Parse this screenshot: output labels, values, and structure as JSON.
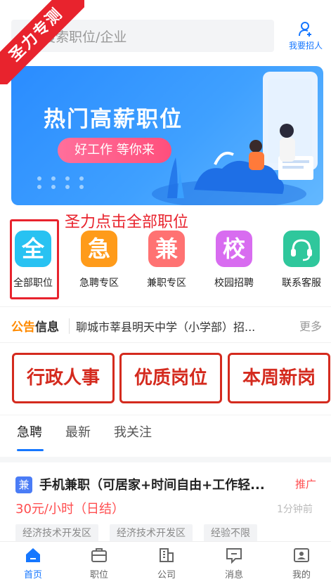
{
  "watermark": "圣力专测",
  "search": {
    "placeholder": "搜索职位/企业"
  },
  "header": {
    "recruit_label": "我要招人"
  },
  "banner": {
    "title": "热门高薪职位",
    "button_label": "好工作 等你来"
  },
  "annotation": "圣力点击全部职位",
  "categories": [
    {
      "icon_char": "全",
      "label": "全部职位",
      "color": "#28c2f2"
    },
    {
      "icon_char": "急",
      "label": "急聘专区",
      "color": "#ff9b1a"
    },
    {
      "icon_char": "兼",
      "label": "兼职专区",
      "color": "#ff7272"
    },
    {
      "icon_char": "校",
      "label": "校园招聘",
      "color": "#d86cf0"
    },
    {
      "icon_char": "",
      "label": "联系客服",
      "color": "#2fc79c"
    }
  ],
  "notice": {
    "logo_a": "公告",
    "logo_b": "信息",
    "text": "聊城市莘县明天中学（小学部）招...",
    "more": "更多"
  },
  "quick_tags": [
    "行政人事",
    "优质岗位",
    "本周新岗"
  ],
  "tabs": [
    "急聘",
    "最新",
    "我关注"
  ],
  "job": {
    "badge": "兼",
    "title": "手机兼职（可居家+时间自由+工作轻...",
    "promo": "推广",
    "salary": "30元/小时（日结）",
    "time": "1分钟前",
    "chips": [
      "经济技术开发区",
      "经济技术开发区",
      "经验不限"
    ]
  },
  "bottom_nav": [
    "首页",
    "职位",
    "公司",
    "消息",
    "我的"
  ],
  "colors": {
    "accent": "#1677ff",
    "highlight": "#e8232d"
  }
}
